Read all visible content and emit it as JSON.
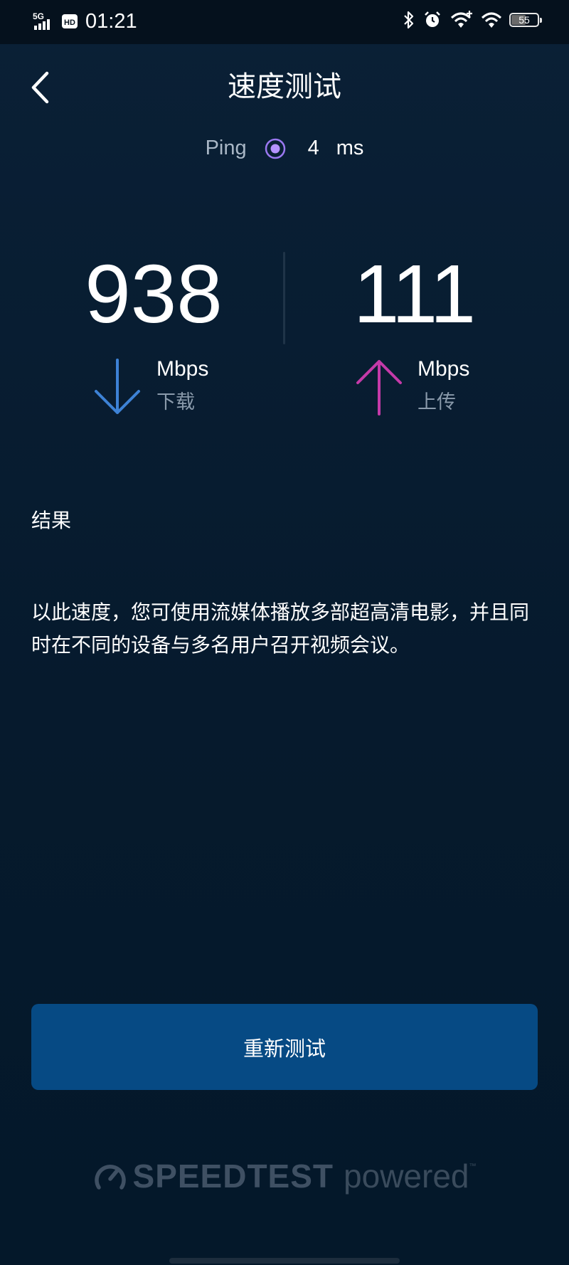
{
  "status_bar": {
    "network": "5G",
    "hd": "HD",
    "time": "01:21",
    "battery": "55",
    "battery_level_percent": 55,
    "icons": [
      "bluetooth-icon",
      "alarm-icon",
      "wifi-plus-icon",
      "wifi-icon",
      "battery-icon"
    ]
  },
  "header": {
    "title": "速度测试",
    "back_icon": "chevron-left-icon"
  },
  "ping": {
    "label": "Ping",
    "value": "4",
    "unit": "ms",
    "icon": "ping-dot-icon"
  },
  "download": {
    "value": "938",
    "unit": "Mbps",
    "label": "下载",
    "icon": "arrow-down-icon",
    "color": "#3d82d6"
  },
  "upload": {
    "value": "111",
    "unit": "Mbps",
    "label": "上传",
    "icon": "arrow-up-icon",
    "color": "#c43aa8"
  },
  "results": {
    "heading": "结果",
    "description": "以此速度，您可使用流媒体播放多部超高清电影，并且同时在不同的设备与多名用户召开视频会议。"
  },
  "actions": {
    "retest_label": "重新测试",
    "button_color": "#064a84"
  },
  "footer": {
    "brand": "SPEEDTEST",
    "powered": "powered",
    "tm": "™",
    "logo_icon": "speedometer-icon"
  }
}
